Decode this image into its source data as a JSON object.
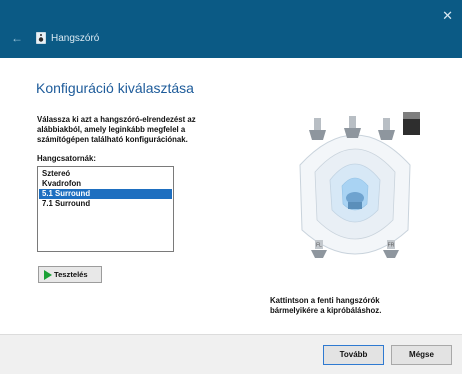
{
  "window": {
    "title": "Hangszóró",
    "back_glyph": "←",
    "close_glyph": "✕",
    "title_bar_color": "#0b5a85"
  },
  "page": {
    "heading": "Konfiguráció kiválasztása",
    "intro_lines": [
      "Válassza ki azt a hangszóró-elrendezést az",
      "alábbiakból, amely leginkább megfelel a",
      "számítógépen található konfigurációnak."
    ],
    "list_label": "Hangcsatornák:",
    "channels": [
      {
        "label": "Sztereó",
        "selected": false
      },
      {
        "label": "Kvadrofon",
        "selected": false
      },
      {
        "label": "5.1 Surround",
        "selected": true
      },
      {
        "label": "7.1 Surround",
        "selected": false
      }
    ],
    "test_button": "Tesztelés",
    "hint_lines": [
      "Kattintson a fenti hangszórók",
      "bármelyikére a kipróbáláshoz."
    ],
    "accent_color": "#1d5b9a",
    "selection_color": "#1e6fc0"
  },
  "diagram": {
    "left_label": "FL",
    "right_label": "FR",
    "icons": [
      "speaker-icon",
      "subwoofer-icon",
      "listener-icon"
    ]
  },
  "footer": {
    "next_button": "Tovább",
    "cancel_button": "Mégse"
  }
}
